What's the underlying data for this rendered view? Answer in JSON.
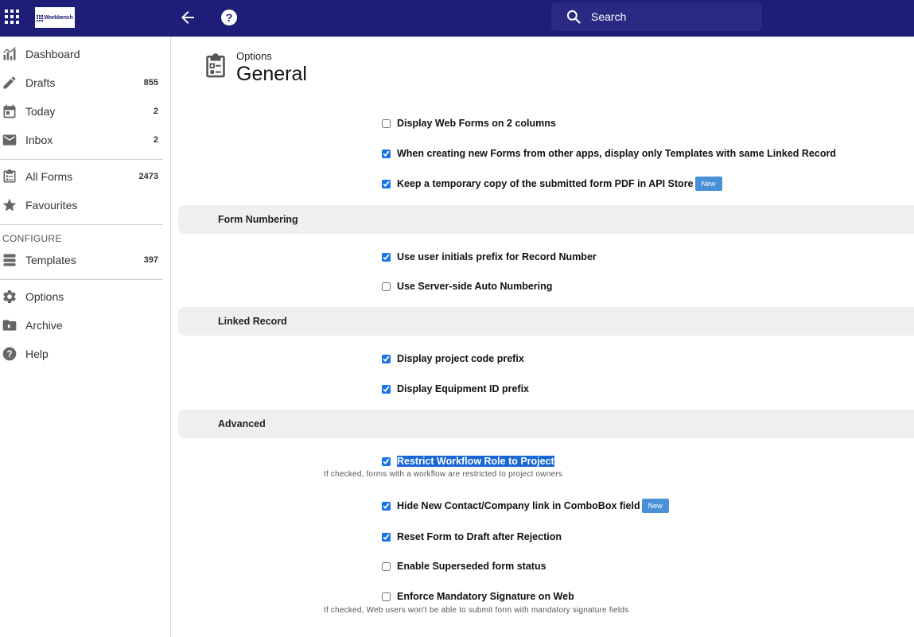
{
  "header": {
    "logo_text": "Workbench",
    "search_placeholder": "Search"
  },
  "sidebar": {
    "items": [
      {
        "label": "Dashboard",
        "icon": "chart-icon"
      },
      {
        "label": "Drafts",
        "count": "855",
        "icon": "pencil-icon"
      },
      {
        "label": "Today",
        "count": "2",
        "icon": "calendar-icon"
      },
      {
        "label": "Inbox",
        "count": "2",
        "icon": "inbox-icon"
      },
      {
        "label": "All Forms",
        "count": "2473",
        "icon": "clipboard-icon"
      },
      {
        "label": "Favourites",
        "icon": "star-icon"
      }
    ],
    "configure_label": "CONFIGURE",
    "configure_items": [
      {
        "label": "Templates",
        "count": "397",
        "icon": "templates-icon"
      }
    ],
    "bottom_items": [
      {
        "label": "Options",
        "icon": "gear-icon"
      },
      {
        "label": "Archive",
        "icon": "archive-icon"
      },
      {
        "label": "Help",
        "icon": "help-icon"
      }
    ]
  },
  "page": {
    "subtitle": "Options",
    "title": "General"
  },
  "general_options": [
    {
      "label": "Display Web Forms on 2 columns",
      "checked": false
    },
    {
      "label": "When creating new Forms from other apps, display only Templates with same Linked Record",
      "checked": true
    },
    {
      "label": "Keep a temporary copy of the submitted form PDF in API Store",
      "checked": true,
      "badge": "New"
    }
  ],
  "sections": {
    "form_numbering": {
      "title": "Form Numbering",
      "options": [
        {
          "label": "Use user initials prefix for Record Number",
          "checked": true
        },
        {
          "label": "Use Server-side Auto Numbering",
          "checked": false
        }
      ]
    },
    "linked_record": {
      "title": "Linked Record",
      "options": [
        {
          "label": "Display project code prefix",
          "checked": true
        },
        {
          "label": "Display Equipment ID prefix",
          "checked": true
        }
      ]
    },
    "advanced": {
      "title": "Advanced",
      "options": [
        {
          "label": "Restrict Workflow Role to Project",
          "checked": true,
          "hint": "If checked, forms with a workflow are restricted to project owners"
        },
        {
          "label": "Hide New Contact/Company link in ComboBox field",
          "checked": true,
          "badge": "New"
        },
        {
          "label": "Reset Form to Draft after Rejection",
          "checked": true
        },
        {
          "label": "Enable Superseded form status",
          "checked": false
        },
        {
          "label": "Enforce Mandatory Signature on Web",
          "checked": false,
          "hint": "If checked, Web users won't be able to submit form with mandatory signature fields"
        }
      ]
    }
  },
  "colors": {
    "topbar": "#1e1e78",
    "accent": "#1a73e8",
    "badge": "#4a90d9",
    "section_bg": "#efefef"
  }
}
